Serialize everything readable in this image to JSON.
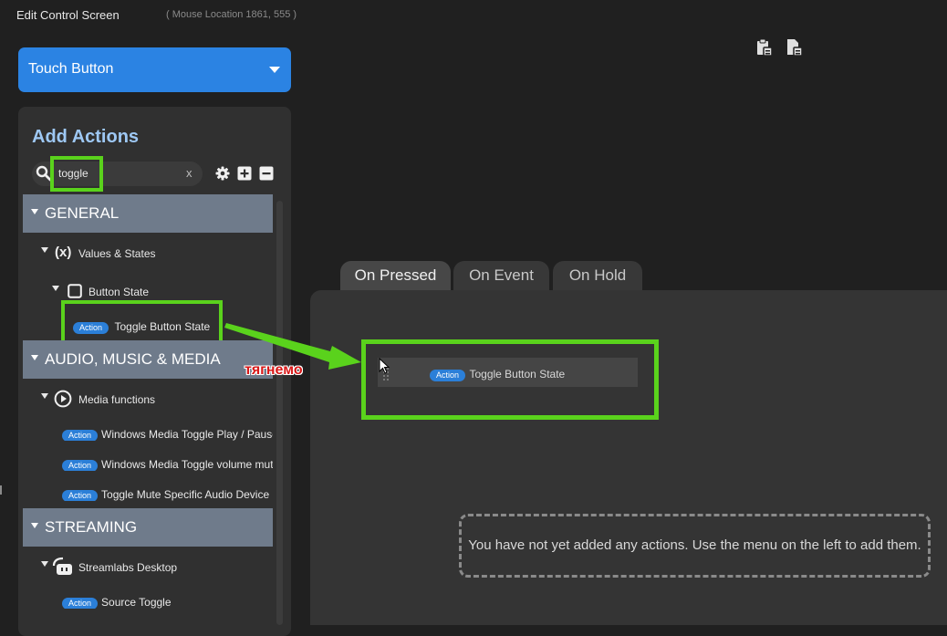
{
  "header": {
    "title": "Edit Control Screen",
    "mouse_location": "( Mouse Location 1861, 555 )"
  },
  "control_type": {
    "selected": "Touch Button"
  },
  "add_actions": {
    "title": "Add Actions",
    "search": {
      "value": "toggle",
      "clear_label": "x"
    }
  },
  "categories": [
    {
      "label": "GENERAL"
    },
    {
      "label": "AUDIO, MUSIC & MEDIA"
    },
    {
      "label": "STREAMING"
    }
  ],
  "tree": {
    "values_states": {
      "icon": "(x)",
      "label": "Values & States"
    },
    "button_state": {
      "label": "Button State"
    },
    "toggle_button_state": {
      "badge": "Action",
      "label": "Toggle Button State"
    },
    "media_functions": {
      "label": "Media functions"
    },
    "media_items": [
      {
        "badge": "Action",
        "label": "Windows Media Toggle Play / Pause"
      },
      {
        "badge": "Action",
        "label": "Windows Media Toggle volume mute"
      },
      {
        "badge": "Action",
        "label": "Toggle Mute Specific Audio Device"
      }
    ],
    "streamlabs": {
      "label": "Streamlabs Desktop"
    },
    "source_toggle": {
      "badge": "Action",
      "label": "Source Toggle"
    }
  },
  "tabs": [
    {
      "label": "On Pressed",
      "active": true
    },
    {
      "label": "On Event",
      "active": false
    },
    {
      "label": "On Hold",
      "active": false
    }
  ],
  "dropped_action": {
    "badge": "Action",
    "label": "Toggle Button State"
  },
  "empty_message": "You have not yet added any actions. Use the menu on the left to add them.",
  "annotation": {
    "caption": "тягнемо",
    "color": "#d81818",
    "highlight_color": "#5ad21c"
  },
  "colors": {
    "accent": "#2b83e3",
    "category_bg": "#6f7b8b",
    "badge": "#2b7fd8"
  },
  "icons": [
    "paste-icon",
    "copy-icon",
    "search-icon",
    "gear-icon",
    "plus-icon",
    "minus-icon",
    "checkbox-icon",
    "play-circle-icon",
    "streamlabs-icon",
    "drag-handle-icon",
    "cursor-icon",
    "arrow-icon"
  ]
}
